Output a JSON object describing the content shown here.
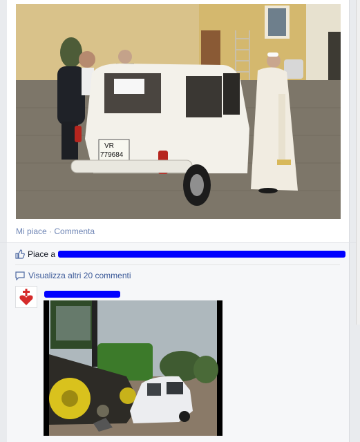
{
  "post": {
    "photo_icon": "photo-car-pope",
    "plate_text": "VR 779684",
    "actions": {
      "like": "Mi piace",
      "separator": "·",
      "comment": "Commenta"
    }
  },
  "feedback": {
    "likes_prefix": "Piace a",
    "more_comments": "Visualizza altri 20 commenti"
  },
  "comment": {
    "avatar_icon": "heart-cross-icon",
    "photo_icon": "photo-tractor-crushed-car"
  },
  "colors": {
    "link": "#6d84b4",
    "redaction": "#0000ff",
    "brand": "#3b5998"
  }
}
